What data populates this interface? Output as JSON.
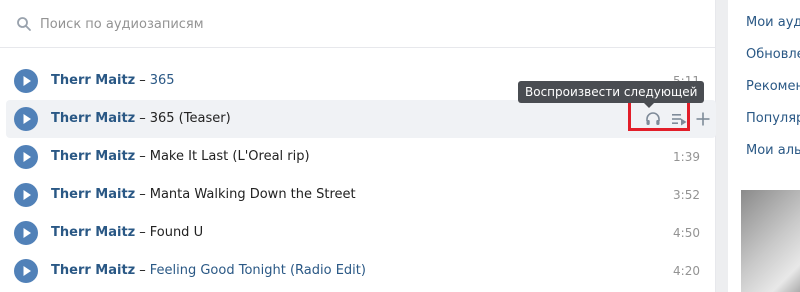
{
  "search": {
    "placeholder": "Поиск по аудиозаписям"
  },
  "tracks": [
    {
      "artist": "Therr Maitz",
      "separator": "–",
      "title": "365",
      "duration": "5:11",
      "title_link": true
    },
    {
      "artist": "Therr Maitz",
      "separator": "–",
      "title": "365 (Teaser)",
      "duration": "",
      "title_link": false
    },
    {
      "artist": "Therr Maitz",
      "separator": "–",
      "title": "Make It Last (L'Oreal rip)",
      "duration": "1:39",
      "title_link": false
    },
    {
      "artist": "Therr Maitz",
      "separator": "–",
      "title": "Manta Walking Down the Street",
      "duration": "3:52",
      "title_link": false
    },
    {
      "artist": "Therr Maitz",
      "separator": "–",
      "title": "Found U",
      "duration": "4:50",
      "title_link": false
    },
    {
      "artist": "Therr Maitz",
      "separator": "–",
      "title": "Feeling Good Tonight (Radio Edit)",
      "duration": "4:20",
      "title_link": true
    }
  ],
  "tooltip": {
    "text": "Воспроизвести следующей"
  },
  "hovered_row_icons": [
    "headphones-icon",
    "play-next-icon",
    "add-icon"
  ],
  "right_nav": {
    "items": [
      "Мои ауди",
      "Обновле",
      "Рекомен",
      "Популяр",
      "Мои аль"
    ]
  },
  "colors": {
    "accent": "#5181b8",
    "link": "#2a5885",
    "highlight": "#e21e29",
    "tooltip_bg": "#4a4d52"
  }
}
